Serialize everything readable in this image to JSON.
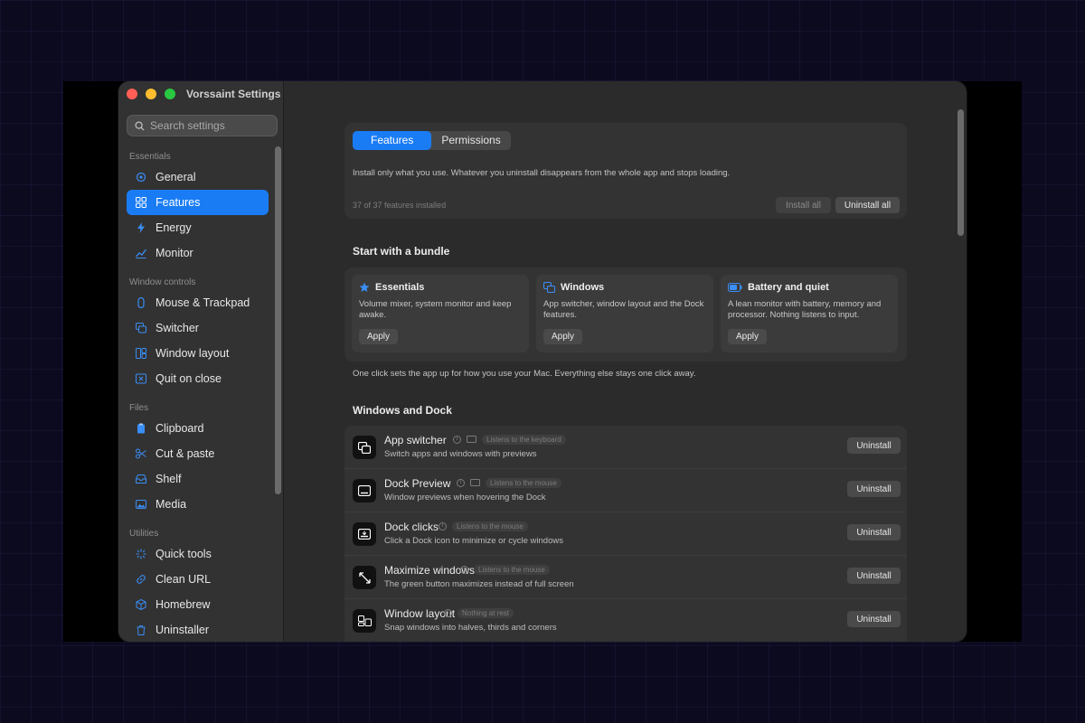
{
  "window": {
    "title": "Vorssaint Settings"
  },
  "search": {
    "placeholder": "Search settings"
  },
  "sidebar": {
    "groups": [
      {
        "label": "Essentials",
        "items": [
          {
            "label": "General",
            "icon": "gear-icon"
          },
          {
            "label": "Features",
            "icon": "grid-icon",
            "active": true
          },
          {
            "label": "Energy",
            "icon": "bolt-icon"
          },
          {
            "label": "Monitor",
            "icon": "chart-icon"
          }
        ]
      },
      {
        "label": "Window controls",
        "items": [
          {
            "label": "Mouse & Trackpad",
            "icon": "mouse-icon"
          },
          {
            "label": "Switcher",
            "icon": "switcher-icon"
          },
          {
            "label": "Window layout",
            "icon": "layout-icon"
          },
          {
            "label": "Quit on close",
            "icon": "close-box-icon"
          }
        ]
      },
      {
        "label": "Files",
        "items": [
          {
            "label": "Clipboard",
            "icon": "clipboard-icon"
          },
          {
            "label": "Cut & paste",
            "icon": "scissors-icon"
          },
          {
            "label": "Shelf",
            "icon": "tray-icon"
          },
          {
            "label": "Media",
            "icon": "photo-icon"
          }
        ]
      },
      {
        "label": "Utilities",
        "items": [
          {
            "label": "Quick tools",
            "icon": "sparkle-icon"
          },
          {
            "label": "Clean URL",
            "icon": "link-icon"
          },
          {
            "label": "Homebrew",
            "icon": "cube-icon"
          },
          {
            "label": "Uninstaller",
            "icon": "trash-icon"
          }
        ]
      }
    ]
  },
  "tabs": {
    "features": "Features",
    "permissions": "Permissions"
  },
  "top_card": {
    "description": "Install only what you use. Whatever you uninstall disappears from the whole app and stops loading.",
    "count": "37 of 37 features installed",
    "install_all": "Install all",
    "uninstall_all": "Uninstall all"
  },
  "bundles_section": {
    "title": "Start with a bundle",
    "note": "One click sets the app up for how you use your Mac. Everything else stays one click away.",
    "items": [
      {
        "title": "Essentials",
        "desc": "Volume mixer, system monitor and keep awake.",
        "button": "Apply",
        "icon": "star-icon"
      },
      {
        "title": "Windows",
        "desc": "App switcher, window layout and the Dock features.",
        "button": "Apply",
        "icon": "windows-icon"
      },
      {
        "title": "Battery and quiet",
        "desc": "A lean monitor with battery, memory and processor. Nothing listens to input.",
        "button": "Apply",
        "icon": "battery-icon"
      }
    ]
  },
  "windows_dock": {
    "title": "Windows and Dock",
    "features": [
      {
        "name": "App switcher",
        "desc": "Switch apps and windows with previews",
        "tag": "Listens to the keyboard",
        "button": "Uninstall",
        "has_screen": true
      },
      {
        "name": "Dock Preview",
        "desc": "Window previews when hovering the Dock",
        "tag": "Listens to the mouse",
        "button": "Uninstall",
        "has_screen": true
      },
      {
        "name": "Dock clicks",
        "desc": "Click a Dock icon to minimize or cycle windows",
        "tag": "Listens to the mouse",
        "button": "Uninstall",
        "has_screen": false
      },
      {
        "name": "Maximize windows",
        "desc": "The green button maximizes instead of full screen",
        "tag": "Listens to the mouse",
        "button": "Uninstall",
        "has_screen": false
      },
      {
        "name": "Window layout",
        "desc": "Snap windows into halves, thirds and corners",
        "tag": "Nothing at rest",
        "button": "Uninstall",
        "has_screen": false
      }
    ]
  },
  "colors": {
    "accent": "#1a7cf5",
    "close": "#fe5f57",
    "minimize": "#febc2e",
    "zoom": "#28c840"
  }
}
